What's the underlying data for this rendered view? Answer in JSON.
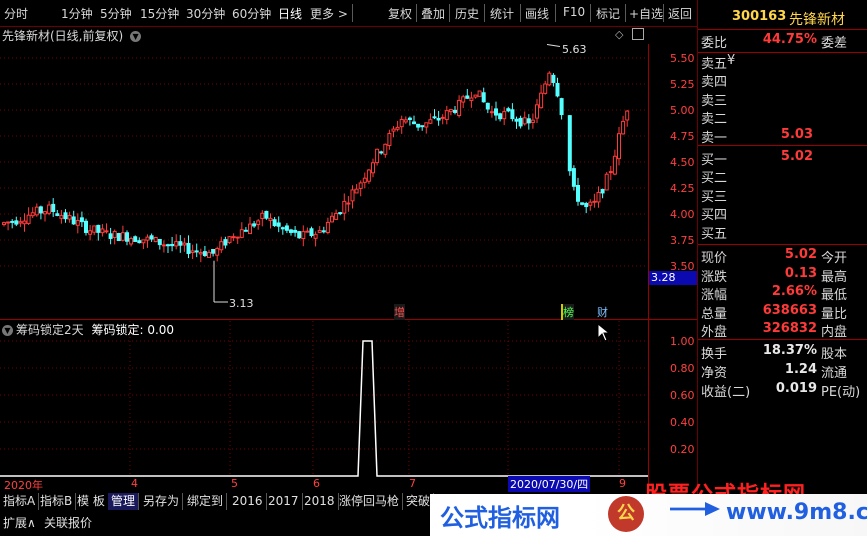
{
  "toolbar": {
    "periods": [
      "分时",
      "1分钟",
      "5分钟",
      "15分钟",
      "30分钟",
      "60分钟",
      "日线",
      "更多 >"
    ],
    "selected": "日线",
    "actions": [
      "复权",
      "叠加",
      "历史",
      "统计",
      "画线",
      "F10",
      "标记",
      "+自选",
      "返回"
    ]
  },
  "chart_title": "先锋新材(日线,前复权)",
  "chart_icons": [
    "chevron-down-icon",
    "diamond-icon",
    "window-icon"
  ],
  "price_axis": [
    "5.50",
    "5.25",
    "5.00",
    "4.75",
    "4.50",
    "4.25",
    "4.00",
    "3.75",
    "3.50"
  ],
  "current_price_tag": "3.28",
  "high_marker": "5.63",
  "low_marker": "3.13",
  "event_marks": [
    "增",
    "榜",
    "财"
  ],
  "indicator": {
    "title": "筹码锁定2天",
    "line_label": "筹码锁定",
    "line_value": "0.00",
    "axis": [
      "1.00",
      "0.80",
      "0.60",
      "0.40",
      "0.20"
    ]
  },
  "date_axis": [
    "2020年",
    "4",
    "5",
    "6",
    "7",
    "2020/07/30/四",
    "9"
  ],
  "bottom_tabs": [
    "指标A",
    "指标B",
    "模 板",
    "管理",
    "另存为",
    "绑定到",
    "2016",
    "2017",
    "2018",
    "涨停回马枪",
    "突破"
  ],
  "bottom_tabs_selected": "管理",
  "bottom_row2": [
    "扩展∧",
    "关联报价"
  ],
  "stock": {
    "code": "300163",
    "name": "先锋新材",
    "weibi_label": "委比",
    "weibi": "44.75%",
    "weicha_label": "委差"
  },
  "orderbook": [
    {
      "label": "卖五",
      "price": "",
      "extra": "¥"
    },
    {
      "label": "卖四",
      "price": ""
    },
    {
      "label": "卖三",
      "price": ""
    },
    {
      "label": "卖二",
      "price": ""
    },
    {
      "label": "卖一",
      "price": "5.03"
    },
    {
      "label": "买一",
      "price": "5.02"
    },
    {
      "label": "买二",
      "price": ""
    },
    {
      "label": "买三",
      "price": ""
    },
    {
      "label": "买四",
      "price": ""
    },
    {
      "label": "买五",
      "price": ""
    }
  ],
  "quote": [
    {
      "l": "现价",
      "v": "5.02",
      "r": "今开"
    },
    {
      "l": "涨跌",
      "v": "0.13",
      "r": "最高"
    },
    {
      "l": "涨幅",
      "v": "2.66%",
      "r": "最低"
    },
    {
      "l": "总量",
      "v": "638663",
      "r": "量比"
    },
    {
      "l": "外盘",
      "v": "326832",
      "r": "内盘"
    },
    {
      "l": "换手",
      "v": "18.37%",
      "r": "股本"
    },
    {
      "l": "净资",
      "v": "1.24",
      "r": "流通"
    },
    {
      "l": "收益(二)",
      "v": "0.019",
      "r": "PE(动)"
    }
  ],
  "watermark": {
    "top": "股票公式指标网",
    "left": "公式指标网",
    "right": "www.9m8.cn"
  },
  "colors": {
    "up": "#ff3a3a",
    "down": "#54ffff",
    "grid": "#7a0000",
    "axis_text": "#ff4040",
    "price_tag_bg": "#0a0ab0"
  }
}
